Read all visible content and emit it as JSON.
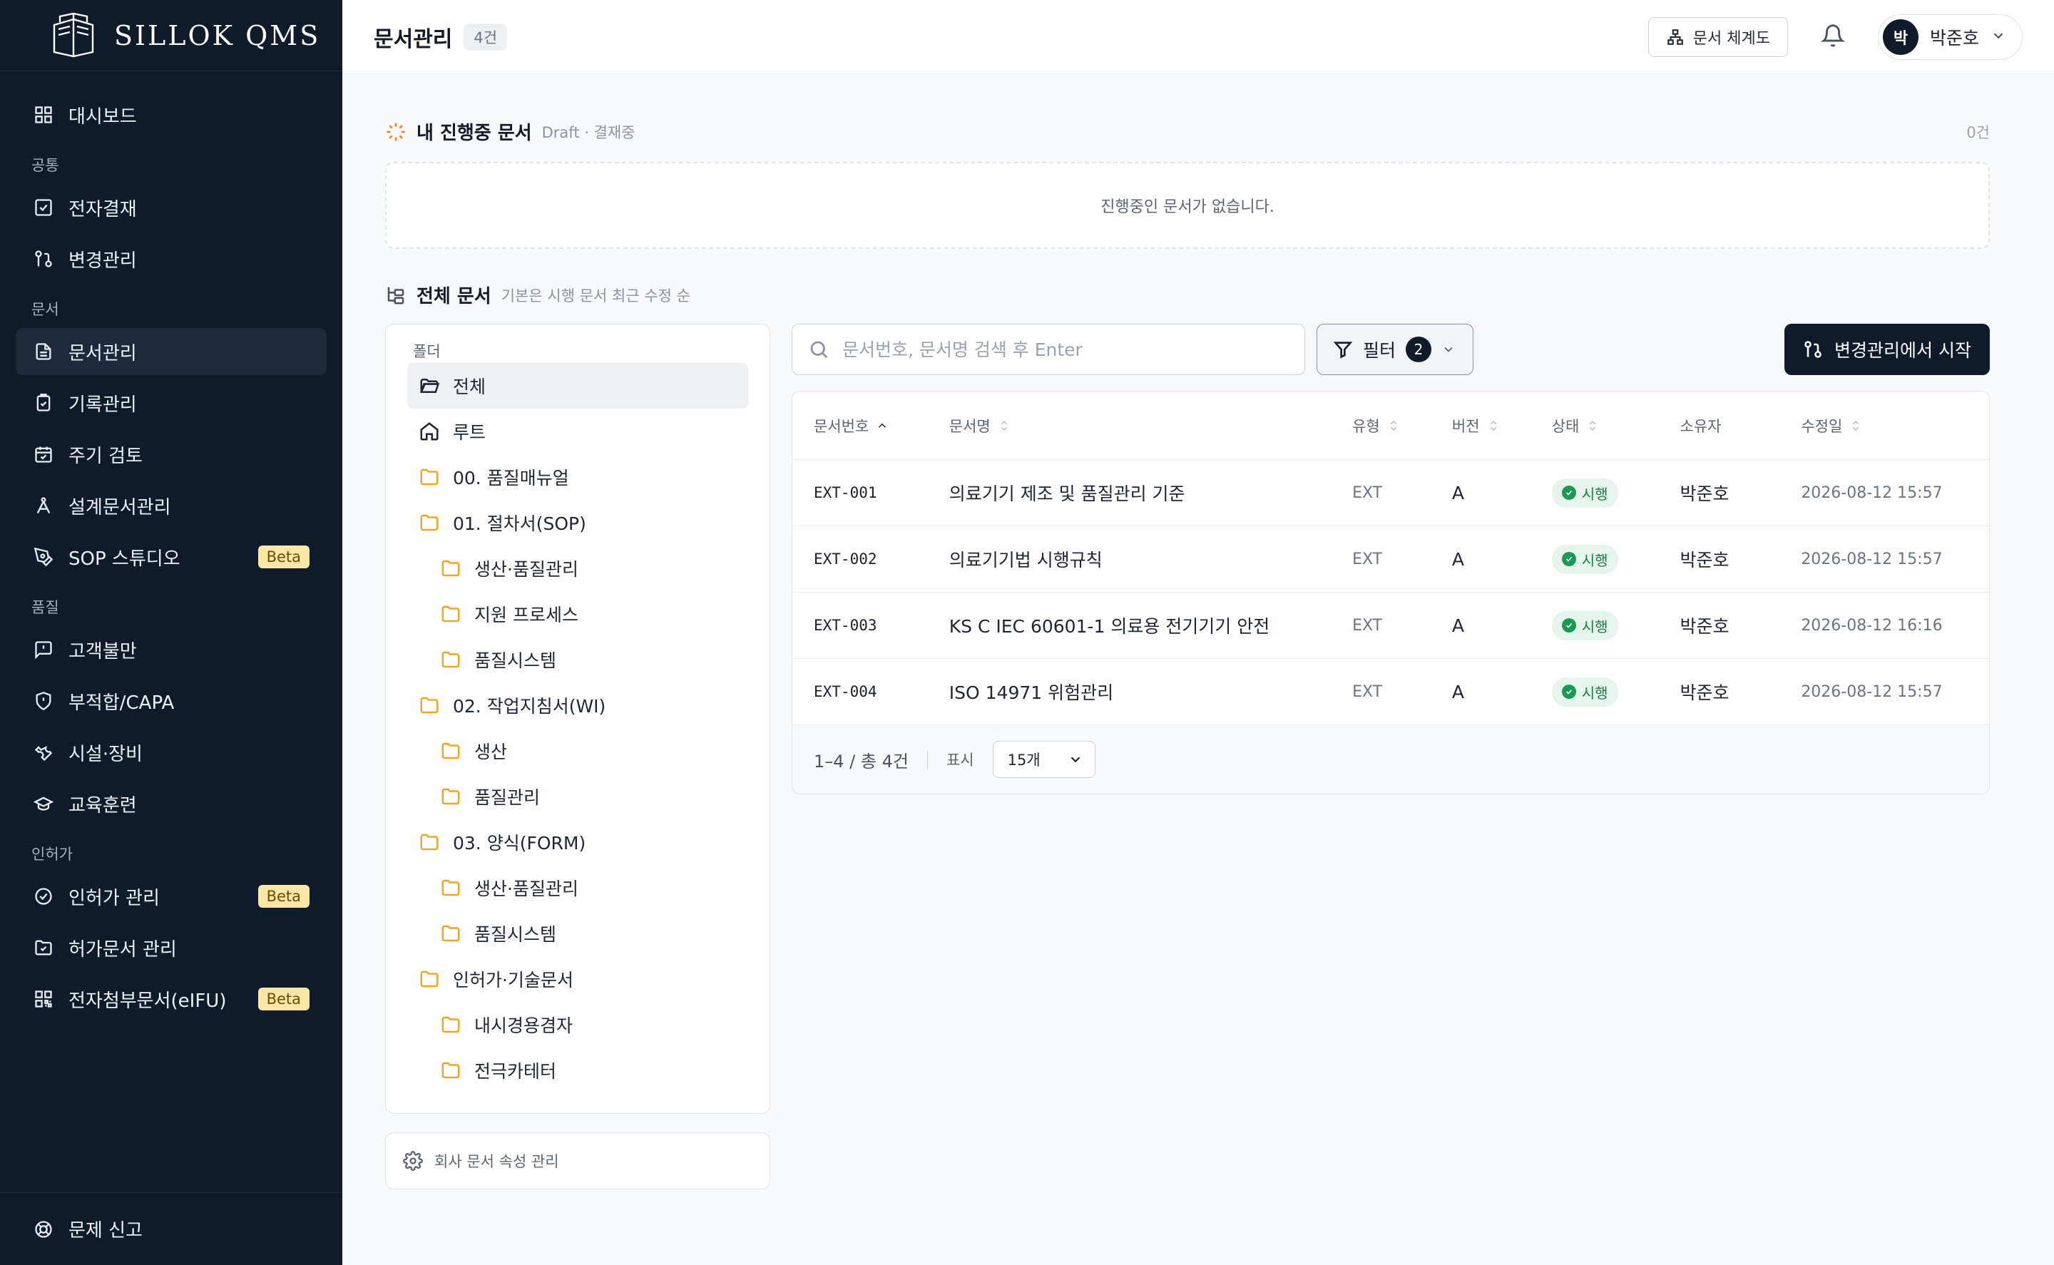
{
  "brand": {
    "name": "SILLOK QMS"
  },
  "sidebar": {
    "dashboard": "대시보드",
    "sections": {
      "common": "공통",
      "document": "문서",
      "quality": "품질",
      "license": "인허가"
    },
    "common_items": [
      "전자결재",
      "변경관리"
    ],
    "document_items": [
      "문서관리",
      "기록관리",
      "주기 검토",
      "설계문서관리",
      "SOP 스튜디오"
    ],
    "quality_items": [
      "고객불만",
      "부적합/CAPA",
      "시설·장비",
      "교육훈련"
    ],
    "license_items": [
      "인허가 관리",
      "허가문서 관리",
      "전자첨부문서(eIFU)"
    ],
    "beta_label": "Beta",
    "footer": "문제 신고"
  },
  "header": {
    "title": "문서관리",
    "count": "4건",
    "hierarchy_button": "문서 체계도",
    "user_initial": "박",
    "user_name": "박준호"
  },
  "in_progress": {
    "title": "내 진행중 문서",
    "subtitle": "Draft · 결재중",
    "count": "0건",
    "empty": "진행중인 문서가 없습니다."
  },
  "all_docs": {
    "title": "전체 문서",
    "subtitle": "기본은 시행 문서 최근 수정 순"
  },
  "folders": {
    "label": "폴더",
    "items": [
      {
        "label": "전체"
      },
      {
        "label": "루트"
      },
      {
        "label": "00. 품질매뉴얼"
      },
      {
        "label": "01. 절차서(SOP)"
      },
      {
        "label": "생산·품질관리"
      },
      {
        "label": "지원 프로세스"
      },
      {
        "label": "품질시스템"
      },
      {
        "label": "02. 작업지침서(WI)"
      },
      {
        "label": "생산"
      },
      {
        "label": "품질관리"
      },
      {
        "label": "03. 양식(FORM)"
      },
      {
        "label": "생산·품질관리"
      },
      {
        "label": "품질시스템"
      },
      {
        "label": "인허가·기술문서"
      },
      {
        "label": "내시경용겸자"
      },
      {
        "label": "전극카테터"
      }
    ],
    "company_attr": "회사 문서 속성 관리"
  },
  "toolbar": {
    "search_placeholder": "문서번호, 문서명 검색 후 Enter",
    "filter_label": "필터",
    "filter_count": "2",
    "start_button": "변경관리에서 시작"
  },
  "table": {
    "columns": [
      "문서번호",
      "문서명",
      "유형",
      "버전",
      "상태",
      "소유자",
      "수정일"
    ],
    "rows": [
      {
        "no": "EXT-001",
        "name": "의료기기 제조 및 품질관리 기준",
        "type": "EXT",
        "ver": "A",
        "status": "시행",
        "owner": "박준호",
        "date": "2026-08-12 15:57"
      },
      {
        "no": "EXT-002",
        "name": "의료기기법 시행규칙",
        "type": "EXT",
        "ver": "A",
        "status": "시행",
        "owner": "박준호",
        "date": "2026-08-12 15:57"
      },
      {
        "no": "EXT-003",
        "name": "KS C IEC 60601-1 의료용 전기기기 안전",
        "type": "EXT",
        "ver": "A",
        "status": "시행",
        "owner": "박준호",
        "date": "2026-08-12 16:16"
      },
      {
        "no": "EXT-004",
        "name": "ISO 14971 위험관리",
        "type": "EXT",
        "ver": "A",
        "status": "시행",
        "owner": "박준호",
        "date": "2026-08-12 15:57"
      }
    ]
  },
  "pagination": {
    "range": "1–4 / 총 4건",
    "show_label": "표시",
    "page_size": "15개"
  },
  "colors": {
    "sidebar_bg": "#0f1b2b",
    "status_green": "#1a9a55",
    "folder_yellow": "#f0a723",
    "beta_bg": "#fde7a6"
  }
}
